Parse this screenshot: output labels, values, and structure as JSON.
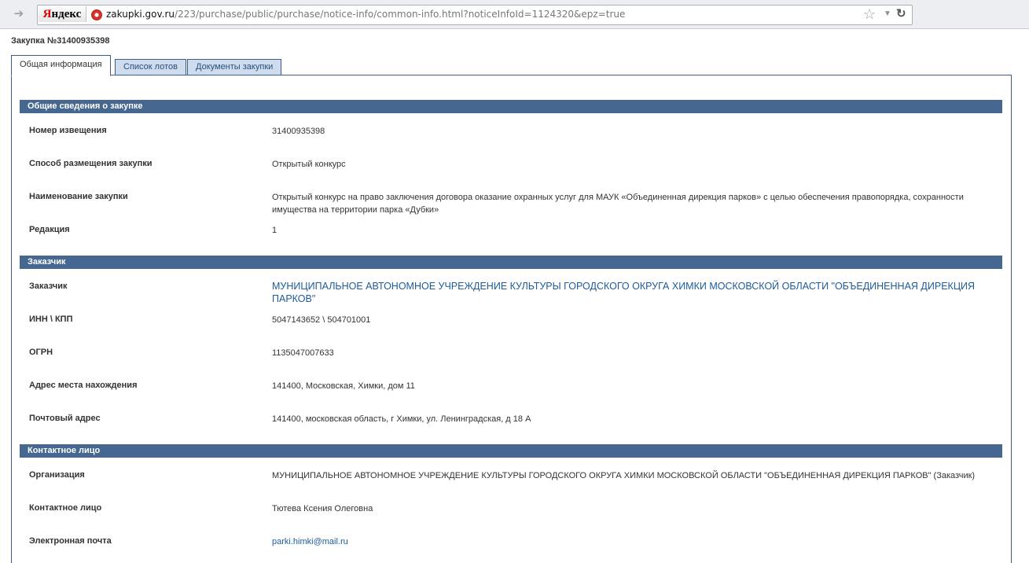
{
  "browser": {
    "logo": "Яндекс",
    "logo_first": "Я",
    "logo_rest": "ндекс",
    "url_host": "zakupki.gov.ru",
    "url_path": "/223/purchase/public/purchase/notice-info/common-info.html?noticeInfoId=1124320&epz=true",
    "icons": {
      "forward": "forward-arrow-icon",
      "star": "star-icon",
      "dropdown": "chevron-down-icon",
      "reload": "reload-icon"
    }
  },
  "page": {
    "title": "Закупка №31400935398"
  },
  "tabs": [
    {
      "label": "Общая информация",
      "active": true
    },
    {
      "label": "Список лотов",
      "active": false
    },
    {
      "label": "Документы закупки",
      "active": false
    }
  ],
  "sections": {
    "general": {
      "header": "Общие сведения о закупке",
      "rows": [
        {
          "label": "Номер извещения",
          "value": "31400935398"
        },
        {
          "label": "Способ размещения закупки",
          "value": "Открытый конкурс"
        },
        {
          "label": "Наименование закупки",
          "value": "Открытый конкурс на право заключения договора оказание охранных услуг для МАУК «Объединенная дирекция парков» с целью обеспечения правопорядка, сохранности имущества на территории парка «Дубки»"
        },
        {
          "label": "Редакция",
          "value": "1"
        }
      ]
    },
    "customer": {
      "header": "Заказчик",
      "rows": [
        {
          "label": "Заказчик",
          "value": "МУНИЦИПАЛЬНОЕ АВТОНОМНОЕ УЧРЕЖДЕНИЕ КУЛЬТУРЫ ГОРОДСКОГО ОКРУГА ХИМКИ МОСКОВСКОЙ ОБЛАСТИ \"ОБЪЕДИНЕННАЯ ДИРЕКЦИЯ ПАРКОВ\""
        },
        {
          "label": "ИНН \\ КПП",
          "value": "5047143652 \\ 504701001"
        },
        {
          "label": "ОГРН",
          "value": "1135047007633"
        },
        {
          "label": "Адрес места нахождения",
          "value": "141400, Московская, Химки, дом 11"
        },
        {
          "label": "Почтовый адрес",
          "value": "141400, московская область, г Химки, ул. Ленинградская, д 18 А"
        }
      ]
    },
    "contact": {
      "header": "Контактное лицо",
      "rows": [
        {
          "label": "Организация",
          "value": "МУНИЦИПАЛЬНОЕ АВТОНОМНОЕ УЧРЕЖДЕНИЕ КУЛЬТУРЫ ГОРОДСКОГО ОКРУГА ХИМКИ МОСКОВСКОЙ ОБЛАСТИ \"ОБЪЕДИНЕННАЯ ДИРЕКЦИЯ ПАРКОВ\" (Заказчик)"
        },
        {
          "label": "Контактное лицо",
          "value": "Тютева Ксения Олеговна"
        },
        {
          "label": "Электронная почта",
          "value": "parki.himki@mail.ru"
        }
      ]
    }
  },
  "colors": {
    "section_header_bg": "#46678f",
    "tab_border": "#3d5f86",
    "link": "#1d5b9a"
  }
}
